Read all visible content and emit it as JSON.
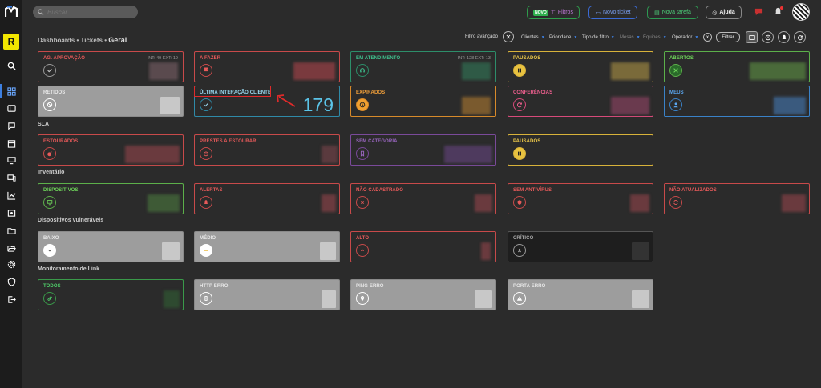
{
  "search": {
    "placeholder": "Buscar"
  },
  "topbar": {
    "filtros_badge": "NOVO",
    "filtros_label": "Filtros",
    "novo_ticket_label": "Novo ticket",
    "nova_tarefa_label": "Nova tarefa",
    "ajuda_label": "Ajuda"
  },
  "sidebar": {
    "badge_letter": "R",
    "items": [
      "search",
      "dashboard",
      "tickets",
      "chat",
      "calendar",
      "desktop",
      "devices",
      "chart",
      "reports",
      "folder",
      "settings",
      "shield",
      "exit"
    ]
  },
  "breadcrumb": {
    "part1": "Dashboards",
    "sep1": "•",
    "part2": "Tickets",
    "sep2": "•",
    "current": "Geral"
  },
  "filters": {
    "advanced_label": "Filtro avançado",
    "advanced_close": "✕",
    "items": [
      {
        "label": "Clientes",
        "dim": false
      },
      {
        "label": "Prioridade",
        "dim": false
      },
      {
        "label": "Tipo de filtro",
        "dim": false
      },
      {
        "label": "Mesas",
        "dim": true
      },
      {
        "label": "Equipes",
        "dim": true
      },
      {
        "label": "Operador",
        "dim": false
      }
    ],
    "clear": "x",
    "apply": "Filtrar"
  },
  "sections": {
    "sla": "SLA",
    "inventario": "Inventário",
    "vulneraveis": "Dispositivos vulneráveis",
    "monitoramento": "Monitoramento de Link"
  },
  "cards": {
    "ag_aprovacao": {
      "title": "AG. APROVAÇÃO",
      "meta": "INT: 49 EXT: 19"
    },
    "a_fazer": {
      "title": "A FAZER"
    },
    "em_atendimento": {
      "title": "EM ATENDIMENTO",
      "meta": "INT: 128 EXT: 13"
    },
    "pausados": {
      "title": "PAUSADOS"
    },
    "abertos": {
      "title": "ABERTOS"
    },
    "retidos": {
      "title": "RETIDOS"
    },
    "ultima_interacao": {
      "title": "ÚLTIMA INTERAÇÃO CLIENTE",
      "value": "179"
    },
    "expirados": {
      "title": "EXPIRADOS"
    },
    "conferencias": {
      "title": "CONFERÊNCIAS"
    },
    "meus": {
      "title": "MEUS"
    },
    "estourados": {
      "title": "ESTOURADOS"
    },
    "prestes": {
      "title": "PRESTES A ESTOURAR"
    },
    "sem_categoria": {
      "title": "SEM CATEGORIA"
    },
    "sla_pausados": {
      "title": "PAUSADOS"
    },
    "dispositivos": {
      "title": "DISPOSITIVOS"
    },
    "alertas": {
      "title": "ALERTAS"
    },
    "nao_cadastrado": {
      "title": "NÃO CADASTRADO"
    },
    "sem_antivirus": {
      "title": "SEM ANTIVÍRUS"
    },
    "nao_atualizados": {
      "title": "NÃO ATUALIZADOS"
    },
    "baixo": {
      "title": "BAIXO"
    },
    "medio": {
      "title": "MÉDIO"
    },
    "alto": {
      "title": "ALTO"
    },
    "critico": {
      "title": "CRÍTICO"
    },
    "todos": {
      "title": "TODOS"
    },
    "http_erro": {
      "title": "HTTP ERRO"
    },
    "ping_erro": {
      "title": "PING ERRO"
    },
    "porta_erro": {
      "title": "PORTA ERRO"
    }
  },
  "colors": {
    "accent": "#3d7fe0",
    "highlight": "#e02a2a",
    "big_value": "#5bc4e8",
    "brand_yellow": "#f2e600"
  }
}
